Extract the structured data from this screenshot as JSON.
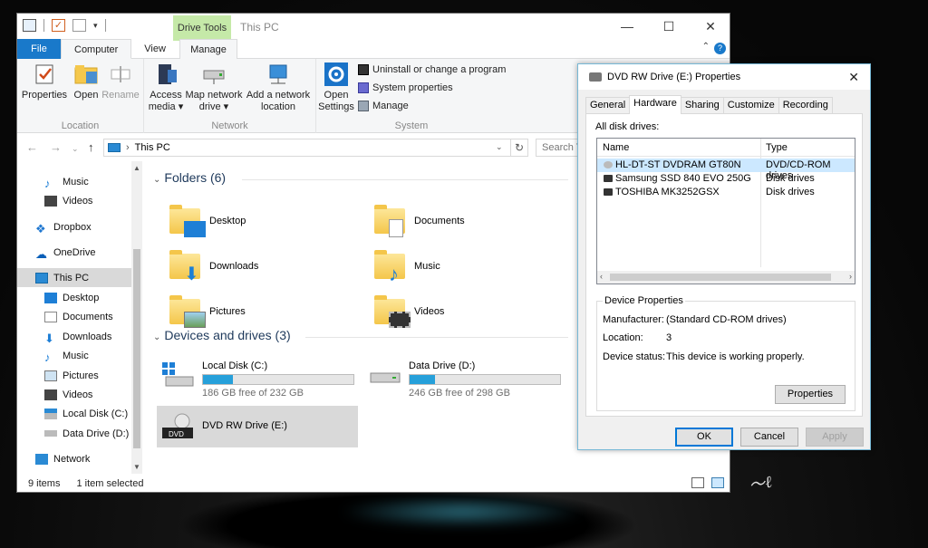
{
  "explorer": {
    "title": "This PC",
    "contextual_tab": "Drive Tools",
    "window_controls": {
      "minimize": "—",
      "maximize": "☐",
      "close": "✕"
    },
    "ribbon_tabs": [
      "File",
      "Computer",
      "View",
      "Manage"
    ],
    "help": "?",
    "ribbon": {
      "location": {
        "label": "Location",
        "buttons": [
          "Properties",
          "Open",
          "Rename"
        ]
      },
      "network": {
        "label": "Network",
        "access_media": "Access",
        "access_media2": "media ▾",
        "map_drive": "Map network",
        "map_drive2": "drive ▾",
        "add_location": "Add a network",
        "add_location2": "location"
      },
      "system": {
        "label": "System",
        "open_settings": "Open",
        "open_settings2": "Settings",
        "uninstall": "Uninstall or change a program",
        "system_properties": "System properties",
        "manage": "Manage"
      }
    },
    "address": {
      "path": "This PC",
      "search_placeholder": "Search T"
    },
    "nav": [
      "Music",
      "Videos",
      "Dropbox",
      "OneDrive",
      "This PC",
      "Desktop",
      "Documents",
      "Downloads",
      "Music",
      "Pictures",
      "Videos",
      "Local Disk (C:)",
      "Data Drive (D:)",
      "Network"
    ],
    "folders_header": "Folders (6)",
    "folders": [
      "Desktop",
      "Documents",
      "Downloads",
      "Music",
      "Pictures",
      "Videos"
    ],
    "devices_header": "Devices and drives (3)",
    "drives": [
      {
        "name": "Local Disk (C:)",
        "free": "186 GB free of 232 GB",
        "used_fraction": 0.2
      },
      {
        "name": "Data Drive (D:)",
        "free": "246 GB free of 298 GB",
        "used_fraction": 0.17
      },
      {
        "name": "DVD RW Drive (E:)",
        "badge": "DVD"
      }
    ],
    "status": {
      "items": "9 items",
      "selected": "1 item selected"
    }
  },
  "dialog": {
    "title": "DVD RW Drive (E:) Properties",
    "close": "✕",
    "tabs": [
      "General",
      "Hardware",
      "Sharing",
      "Customize",
      "Recording"
    ],
    "all_disk_drives": "All disk drives:",
    "columns": [
      "Name",
      "Type"
    ],
    "rows": [
      {
        "name": "HL-DT-ST DVDRAM GT80N",
        "type": "DVD/CD-ROM drives"
      },
      {
        "name": "Samsung SSD 840 EVO 250G",
        "type": "Disk drives"
      },
      {
        "name": "TOSHIBA MK3252GSX",
        "type": "Disk drives"
      }
    ],
    "device_properties": {
      "legend": "Device Properties",
      "manufacturer_label": "Manufacturer:",
      "manufacturer": "(Standard CD-ROM drives)",
      "location_label": "Location:",
      "location": "3",
      "status_label": "Device status:",
      "status": "This device is working properly.",
      "properties_button": "Properties"
    },
    "buttons": {
      "ok": "OK",
      "cancel": "Cancel",
      "apply": "Apply"
    }
  }
}
